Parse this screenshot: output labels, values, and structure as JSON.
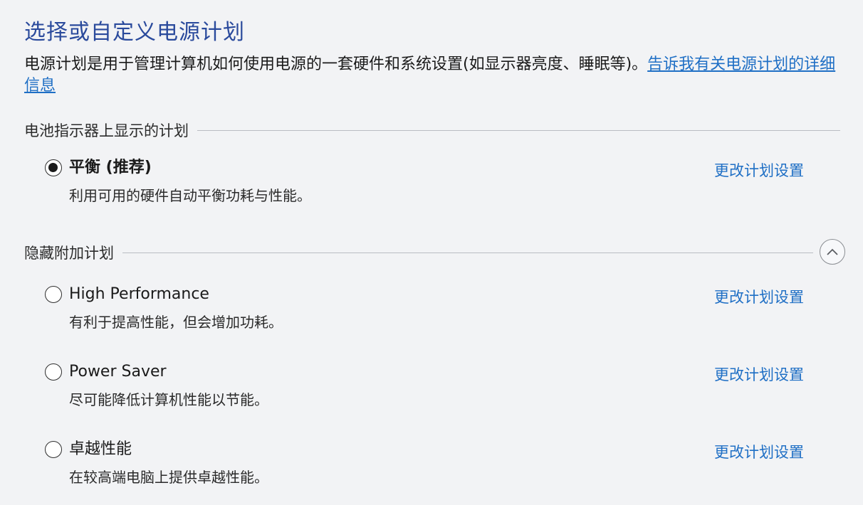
{
  "page": {
    "title": "选择或自定义电源计划",
    "description": "电源计划是用于管理计算机如何使用电源的一套硬件和系统设置(如显示器亮度、睡眠等)。",
    "learn_more_link": "告诉我有关电源计划的详细信息"
  },
  "sections": {
    "battery_plans_label": "电池指示器上显示的计划",
    "hidden_plans_label": "隐藏附加计划",
    "collapse_icon": "chevron-up-icon"
  },
  "plans": [
    {
      "name": "平衡 (推荐)",
      "description": "利用可用的硬件自动平衡功耗与性能。",
      "selected": true,
      "change_label": "更改计划设置"
    },
    {
      "name": "High Performance",
      "description": "有利于提高性能，但会增加功耗。",
      "selected": false,
      "change_label": "更改计划设置"
    },
    {
      "name": "Power Saver",
      "description": "尽可能降低计算机性能以节能。",
      "selected": false,
      "change_label": "更改计划设置"
    },
    {
      "name": "卓越性能",
      "description": "在较高端电脑上提供卓越性能。",
      "selected": false,
      "change_label": "更改计划设置"
    }
  ],
  "colors": {
    "title": "#2a4a9c",
    "link": "#1f6fc5",
    "background": "#f2f3f5"
  }
}
